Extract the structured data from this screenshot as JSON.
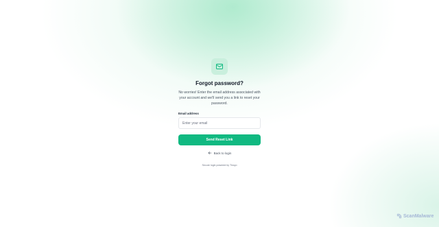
{
  "header": {
    "title": "Forgot password?",
    "description": "No worries! Enter the email address associated with your account and we'll send you a link to reset your password."
  },
  "form": {
    "email_label": "Email address",
    "email_placeholder": "Enter your email",
    "email_value": "",
    "submit_label": "Send Reset Link"
  },
  "back_link": {
    "label": "Back to login"
  },
  "footer": {
    "text": "Secure login powered by Tincyo"
  },
  "watermark": {
    "text": "ScanMalware"
  },
  "colors": {
    "accent": "#10b981",
    "icon_tile_bg": "#c9efdd",
    "icon_stroke": "#10b981"
  },
  "icons": {
    "header_icon": "mail-icon",
    "back_icon": "arrow-left-icon",
    "watermark_icon": "scanmalware-logo-icon"
  }
}
